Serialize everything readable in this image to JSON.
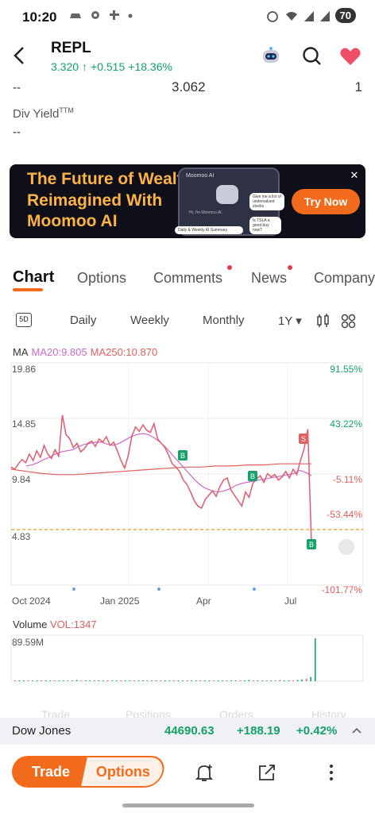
{
  "status": {
    "time": "10:20",
    "battery": "70"
  },
  "header": {
    "ticker": "REPL",
    "price": "3.320",
    "arrow": "↑",
    "change": "+0.515",
    "change_pct": "+18.36%"
  },
  "stats": {
    "left": "--",
    "mid": "3.062",
    "right": "1",
    "div_label": "Div Yield",
    "div_sup": "TTM",
    "div_value": "--"
  },
  "banner": {
    "title_lines": [
      "The Future of Wealth,",
      "Reimagined With",
      "Moomoo AI"
    ],
    "phone_title": "Moomoo AI",
    "phone_msg": "Hi, I'm Moomoo AI.",
    "bubble1": "Give me a list of undervalued stocks",
    "bubble2": "Is TSLA a good buy now?",
    "summary": "Daily & Weekly AI Summary",
    "cta": "Try Now",
    "close": "✕"
  },
  "tabs": [
    "Chart",
    "Options",
    "Comments",
    "News",
    "Company"
  ],
  "ranges": {
    "five_day": "5D",
    "daily": "Daily",
    "weekly": "Weekly",
    "monthly": "Monthly",
    "one_year": "1Y ▾"
  },
  "ma_legend": {
    "label": "MA",
    "ma20": "MA20:9.805",
    "ma250": "MA250:10.870"
  },
  "chart_data": {
    "type": "candlestick",
    "y_labels": [
      "19.86",
      "14.85",
      "9.84",
      "4.83"
    ],
    "pct_labels": [
      "91.55%",
      "43.22%",
      "-5.11%",
      "-53.44%",
      "-101.77%"
    ],
    "x_labels": [
      "Oct 2024",
      "Jan 2025",
      "Apr",
      "Jul"
    ],
    "markers": [
      "B",
      "B",
      "S",
      "B"
    ],
    "price_series": [
      10.6,
      10.4,
      10.9,
      11.3,
      11.0,
      11.8,
      11.2,
      12.1,
      11.5,
      12.6,
      11.8,
      11.4,
      12.2,
      11.6,
      15.4,
      13.6,
      13.2,
      12.4,
      12.8,
      12.0,
      12.3,
      12.8,
      13.0,
      12.5,
      13.2,
      12.9,
      13.4,
      12.6,
      12.9,
      12.1,
      11.2,
      10.5,
      11.7,
      13.5,
      14.3,
      13.9,
      14.5,
      14.0,
      13.8,
      14.6,
      13.2,
      12.8,
      12.4,
      11.7,
      10.9,
      10.6,
      10.2,
      9.4,
      9.0,
      8.3,
      7.5,
      7.0,
      6.8,
      7.6,
      8.0,
      8.4,
      7.9,
      8.8,
      9.4,
      9.6,
      8.5,
      8.0,
      7.5,
      7.0,
      8.3,
      7.8,
      9.1,
      9.5,
      9.8,
      9.2,
      10.0,
      9.7,
      9.9,
      9.4,
      9.7,
      10.2,
      9.6,
      10.4,
      9.9,
      11.2,
      12.3,
      14.1,
      3.6
    ],
    "ma20_series": [
      10.7,
      10.8,
      11.0,
      11.3,
      11.5,
      11.8,
      12.0,
      12.1,
      12.2,
      12.5,
      12.7,
      12.8,
      12.9,
      12.9,
      12.7,
      12.6,
      12.8,
      13.1,
      13.4,
      13.6,
      13.7,
      13.6,
      13.3,
      12.9,
      12.4,
      11.8,
      11.2,
      10.6,
      10.0,
      9.4,
      8.9,
      8.6,
      8.4,
      8.3,
      8.4,
      8.6,
      8.9,
      9.1,
      9.2,
      9.3,
      9.4,
      9.5,
      9.6,
      9.7,
      9.8,
      9.9,
      10.0,
      10.3,
      10.1,
      9.8
    ],
    "ma250_series": [
      10.4,
      10.2,
      10.0,
      9.9,
      9.9,
      10.0,
      10.1,
      10.2,
      10.3,
      10.4,
      10.5,
      10.6,
      10.6,
      10.7,
      10.7,
      10.8,
      10.8,
      10.9,
      10.9,
      10.9
    ],
    "volume_series": [
      2,
      1,
      1,
      2,
      1,
      1,
      1,
      2,
      1,
      1,
      1,
      1,
      2,
      1,
      3,
      1,
      1,
      1,
      1,
      1,
      2,
      1,
      1,
      1,
      1,
      1,
      1,
      2,
      1,
      1,
      1,
      1,
      1,
      1,
      1,
      2,
      1,
      1,
      1,
      1,
      1,
      2,
      1,
      1,
      1,
      1,
      1,
      1,
      1,
      2,
      1,
      1,
      2,
      3,
      1,
      1,
      1,
      1,
      1,
      1,
      3,
      1,
      1,
      2,
      3,
      4,
      6,
      10,
      100
    ]
  },
  "volume": {
    "label": "Volume",
    "vol": "VOL:1347",
    "max": "89.59M"
  },
  "index": {
    "name": "Dow Jones",
    "value": "44690.63",
    "change": "+188.19",
    "change_pct": "+0.42%"
  },
  "bottom": {
    "trade": "Trade",
    "options": "Options"
  },
  "ghost": [
    "Trade",
    "Positions",
    "Orders",
    "History"
  ],
  "colors": {
    "green": "#16a06a",
    "red": "#e06060",
    "orange": "#f26b1d",
    "ma20": "#c86ac8"
  }
}
